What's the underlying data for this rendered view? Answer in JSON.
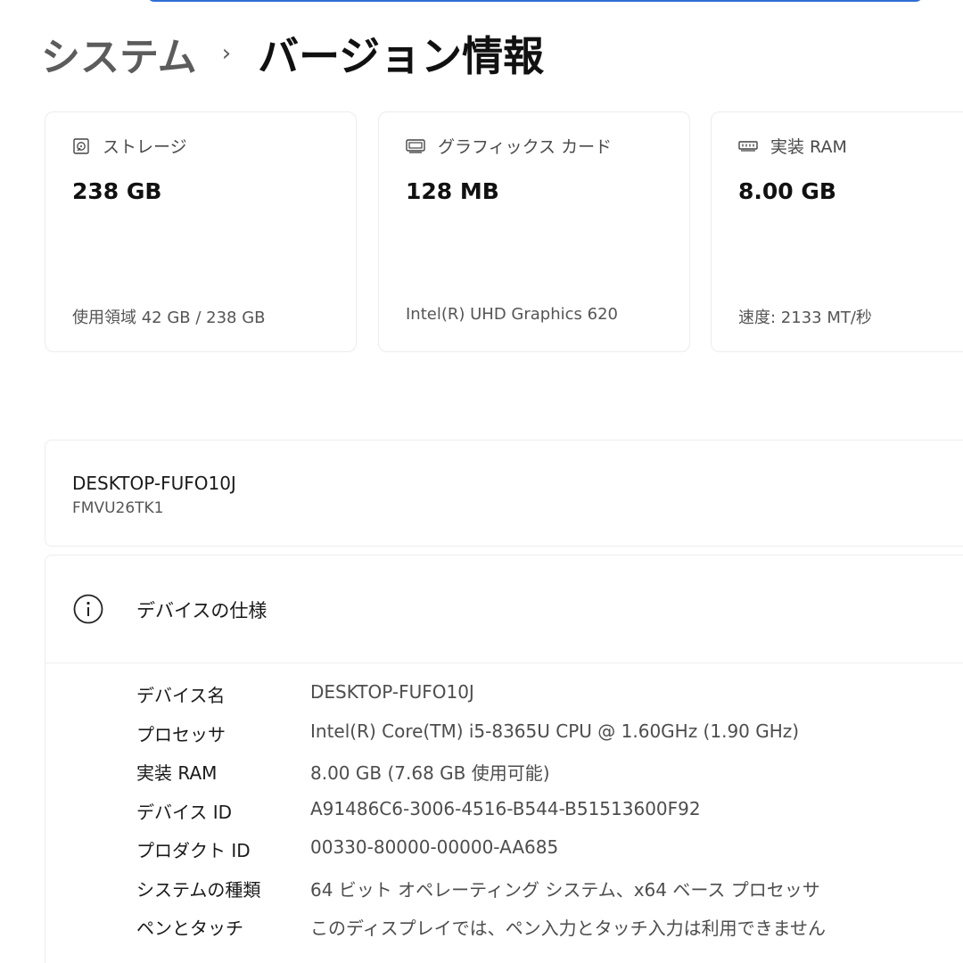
{
  "breadcrumb": {
    "parent": "システム",
    "separator": "›",
    "current": "バージョン情報"
  },
  "cards": [
    {
      "icon": "storage-icon",
      "label": "ストレージ",
      "value": "238 GB",
      "sub": "使用領域 42 GB / 238 GB"
    },
    {
      "icon": "graphics-card-icon",
      "label": "グラフィックス カード",
      "value": "128 MB",
      "sub": "Intel(R) UHD Graphics 620"
    },
    {
      "icon": "ram-icon",
      "label": "実装 RAM",
      "value": "8.00 GB",
      "sub": "速度: 2133 MT/秒"
    }
  ],
  "device": {
    "name": "DESKTOP-FUFO10J",
    "model": "FMVU26TK1"
  },
  "specs": {
    "title": "デバイスの仕様",
    "rows": [
      {
        "label": "デバイス名",
        "value": "DESKTOP-FUFO10J"
      },
      {
        "label": "プロセッサ",
        "value": "Intel(R) Core(TM) i5-8365U CPU @ 1.60GHz (1.90 GHz)"
      },
      {
        "label": "実装 RAM",
        "value": "8.00 GB (7.68 GB 使用可能)"
      },
      {
        "label": "デバイス ID",
        "value": "A91486C6-3006-4516-B544-B51513600F92"
      },
      {
        "label": "プロダクト ID",
        "value": "00330-80000-00000-AA685"
      },
      {
        "label": "システムの種類",
        "value": "64 ビット オペレーティング システム、x64 ベース プロセッサ"
      },
      {
        "label": "ペンとタッチ",
        "value": "このディスプレイでは、ペン入力とタッチ入力は利用できません"
      }
    ]
  },
  "colors": {
    "accent": "#2f6fd4",
    "text_primary": "#1a1a1a",
    "text_secondary": "#555555",
    "card_border": "#ececec"
  }
}
